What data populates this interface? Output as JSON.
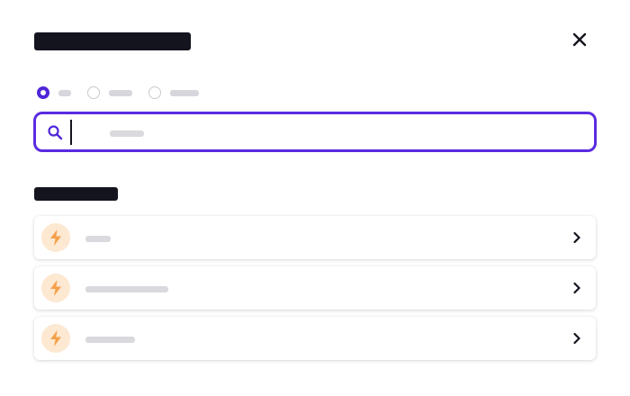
{
  "modal": {
    "title": "",
    "close_icon": "close-icon"
  },
  "filter": {
    "options": [
      {
        "label": "",
        "checked": true
      },
      {
        "label": "",
        "checked": false
      },
      {
        "label": "",
        "checked": false
      }
    ]
  },
  "search": {
    "icon": "search-icon",
    "value": "",
    "placeholder": ""
  },
  "section": {
    "heading": ""
  },
  "items": [
    {
      "label": "",
      "icon": "lightning-icon"
    },
    {
      "label": "",
      "icon": "lightning-icon"
    },
    {
      "label": "",
      "icon": "lightning-icon"
    }
  ],
  "colors": {
    "accent": "#5a2be0",
    "radio_checked": "#4f26d8",
    "item_icon_bg": "#fde8d2",
    "item_icon_fg": "#f5a04a",
    "heading": "#14141f"
  }
}
